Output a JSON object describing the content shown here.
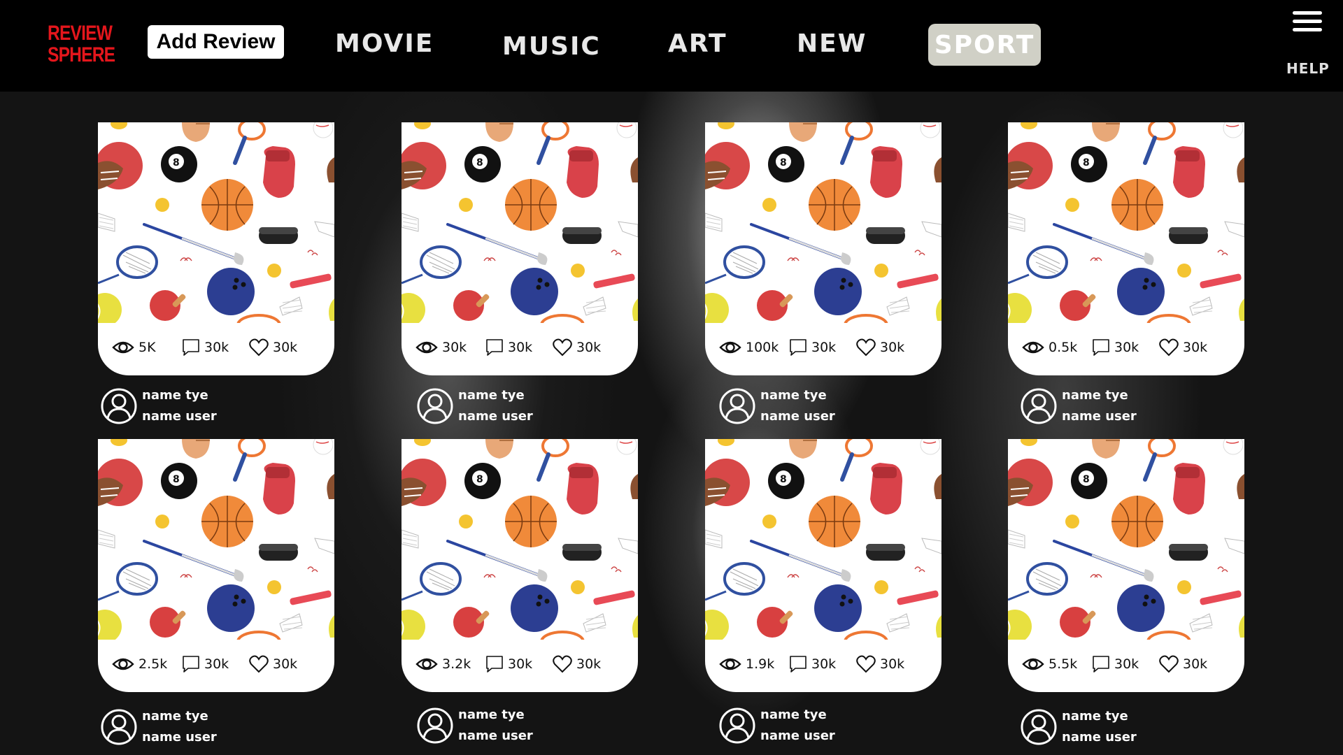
{
  "header": {
    "logo_line1": "REVIEW",
    "logo_line2": "SPHERE",
    "add_review_label": "Add Review",
    "nav": [
      {
        "label": "MOVIE",
        "active": false
      },
      {
        "label": "MUSIC",
        "active": false
      },
      {
        "label": "ART",
        "active": false
      },
      {
        "label": "NEW",
        "active": false
      },
      {
        "label": "SPORT",
        "active": true
      }
    ],
    "menu_icon": "hamburger-icon",
    "help_label": "HELP"
  },
  "colors": {
    "logo": "#e4161c",
    "active_tab": "#d0d0c6",
    "topbar": "#000000"
  },
  "cards": [
    {
      "views": "5K",
      "comments": "30k",
      "likes": "30k",
      "name_type": "name tye",
      "name_user": "name user"
    },
    {
      "views": "30k",
      "comments": "30k",
      "likes": "30k",
      "name_type": "name tye",
      "name_user": "name user"
    },
    {
      "views": "100k",
      "comments": "30k",
      "likes": "30k",
      "name_type": "name tye",
      "name_user": "name user"
    },
    {
      "views": "0.5k",
      "comments": "30k",
      "likes": "30k",
      "name_type": "name tye",
      "name_user": "name user"
    },
    {
      "views": "2.5k",
      "comments": "30k",
      "likes": "30k",
      "name_type": "name tye",
      "name_user": "name user"
    },
    {
      "views": "3.2k",
      "comments": "30k",
      "likes": "30k",
      "name_type": "name tye",
      "name_user": "name user"
    },
    {
      "views": "1.9k",
      "comments": "30k",
      "likes": "30k",
      "name_type": "name tye",
      "name_user": "name user"
    },
    {
      "views": "5.5k",
      "comments": "30k",
      "likes": "30k",
      "name_type": "name tye",
      "name_user": "name user"
    }
  ]
}
